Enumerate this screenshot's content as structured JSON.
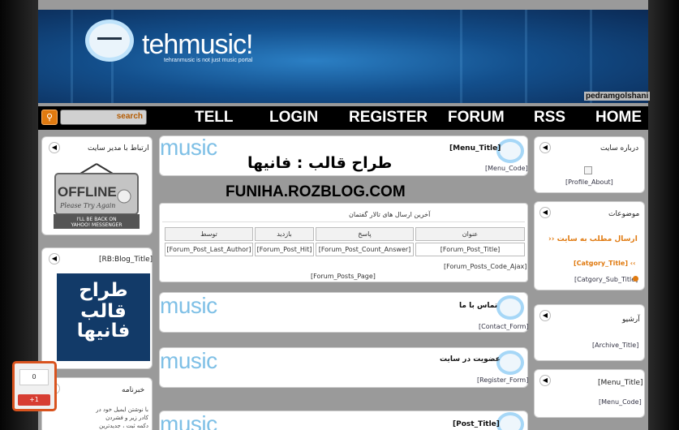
{
  "header": {
    "logo_text": "tehmusic!",
    "tagline": "tehranmusic is not just music portal",
    "owner": "pedramgolshani"
  },
  "nav": {
    "search_placeholder": "search",
    "links": [
      "TELL",
      "LOGIN",
      "REGISTER",
      "FORUM",
      "RSS",
      "HOME"
    ]
  },
  "overlay": {
    "line1": "طراح قالب : فانیها",
    "line2": "FUNIHA.ROZBLOG.COM"
  },
  "left": {
    "contact_title": "ارتباط با مدیر سایت",
    "offline": {
      "sign": "OFFLINE",
      "sub": "Please Try Again",
      "msg1": "I'LL BE BACK ON",
      "msg2": "YAHOO! MESSENGER"
    },
    "blog_title": "[RB:Blog_Title]",
    "promo_line1": "طراح قالب",
    "promo_line2": "فانیها",
    "news_title": "خبرنامه",
    "news_text": "با نوشتن ایمیل خود در کادر زیر و فشردن دکمه ثبت ، جدیدترین مطالب و آهنگهای سایت را در ایمیل خود"
  },
  "center": {
    "music_label": "music",
    "post1": {
      "title": "[Menu_Title]",
      "code": "[Menu_Code]"
    },
    "forum": {
      "title": "آخرین ارسال های تالار گفتمان",
      "headers": [
        "عنوان",
        "پاسخ",
        "بازدید",
        "توسط"
      ],
      "row": [
        "[Forum_Post_Title]",
        "[Forum_Post_Count_Answer]",
        "[Forum_Post_Hit]",
        "[Forum_Post_Last_Author]"
      ],
      "ajax": "[Forum_Posts_Code_Ajax]",
      "page": "[Forum_Posts_Page]"
    },
    "contact": {
      "title": "تماس با ما",
      "code": "[Contact_Form]"
    },
    "register": {
      "title": "عضویت در سایت",
      "code": "[Register_Form]"
    },
    "post2": {
      "title": "[Post_Title]"
    }
  },
  "right": {
    "about_title": "درباره سایت",
    "about_link": "[Profile_About]",
    "topics_title": "موضوعات",
    "send_post": "ارسال مطلب به سایت",
    "cat_title": "[Catgory_Title]",
    "cat_sub": "[Catgory_Sub_Title]",
    "archive_title": "آرشیو",
    "archive_link": "[Archive_Title]",
    "menu_title": "[Menu_Title]",
    "menu_code": "[Menu_Code]"
  },
  "share": {
    "count": "0",
    "button": "+1"
  },
  "colors": {
    "accent": "#e07a10",
    "header": "#134f8c",
    "music": "#7fc0e6"
  }
}
